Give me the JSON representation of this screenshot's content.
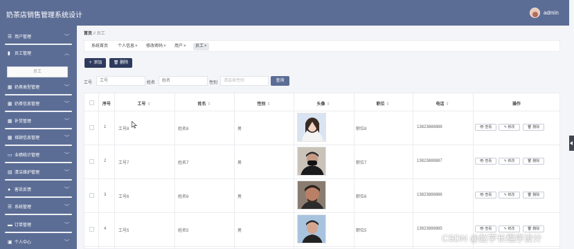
{
  "app": {
    "title": "奶茶店销售管理系统设计",
    "user": "admin"
  },
  "colors": {
    "primary": "#5c6d95",
    "dark_button": "#2e3b5e"
  },
  "sidebar": {
    "items": [
      {
        "label": "用户管理",
        "icon": "list-icon",
        "expanded": false
      },
      {
        "label": "员工管理",
        "icon": "bar-chart-icon",
        "expanded": true
      },
      {
        "label": "奶茶类型管理",
        "icon": "grid-icon",
        "expanded": false
      },
      {
        "label": "奶茶信息管理",
        "icon": "grid-icon",
        "expanded": false
      },
      {
        "label": "补货管理",
        "icon": "grid-icon",
        "expanded": false
      },
      {
        "label": "择顾信息管理",
        "icon": "grid-icon",
        "expanded": false
      },
      {
        "label": "业绩统计管理",
        "icon": "monitor-icon",
        "expanded": false
      },
      {
        "label": "清洁维护管理",
        "icon": "doc-icon",
        "expanded": false
      },
      {
        "label": "客诉反馈",
        "icon": "user-icon",
        "expanded": false
      },
      {
        "label": "系统管理",
        "icon": "list-icon",
        "expanded": false
      },
      {
        "label": "订单管理",
        "icon": "folder-icon",
        "expanded": false
      },
      {
        "label": "个人中心",
        "icon": "card-icon",
        "expanded": false
      }
    ],
    "submenu_label": "员工"
  },
  "breadcrumb": {
    "home": "首页",
    "separator": "//",
    "current": "员工"
  },
  "tabs": [
    {
      "label": "系统首页",
      "closable": false
    },
    {
      "label": "个人信息",
      "closable": true
    },
    {
      "label": "修改密码",
      "closable": true
    },
    {
      "label": "用户",
      "closable": true
    },
    {
      "label": "员工",
      "closable": true
    }
  ],
  "close_mark": "×",
  "actions": {
    "add": "＋ 添加",
    "delete": "🗑 删除"
  },
  "filters": {
    "id_label": "工号",
    "id_placeholder": "工号",
    "name_label": "姓名",
    "name_placeholder": "姓名",
    "gender_label": "性别",
    "gender_placeholder": "请选择性别",
    "search": "查询"
  },
  "table": {
    "columns": {
      "index": "序号",
      "id": "工号",
      "name": "姓名",
      "gender": "性别",
      "photo": "头像",
      "position": "职位",
      "phone": "电话",
      "ops": "操作"
    },
    "sort_mark": "⇕",
    "row_buttons": {
      "view": "👁 查看",
      "edit": "✎ 修改",
      "delete": "🗑 删除"
    },
    "rows": [
      {
        "index": "1",
        "id": "工号8",
        "name": "姓名8",
        "gender": "男",
        "position": "职位8",
        "phone": "13823888888"
      },
      {
        "index": "2",
        "id": "工号7",
        "name": "姓名7",
        "gender": "男",
        "position": "职位7",
        "phone": "13823888887"
      },
      {
        "index": "3",
        "id": "工号6",
        "name": "姓名6",
        "gender": "男",
        "position": "职位6",
        "phone": "13823888886"
      },
      {
        "index": "4",
        "id": "工号5",
        "name": "姓名5",
        "gender": "男",
        "position": "职位5",
        "phone": "13823888885"
      }
    ]
  },
  "watermark": "CSDN @赵学长程序设计"
}
